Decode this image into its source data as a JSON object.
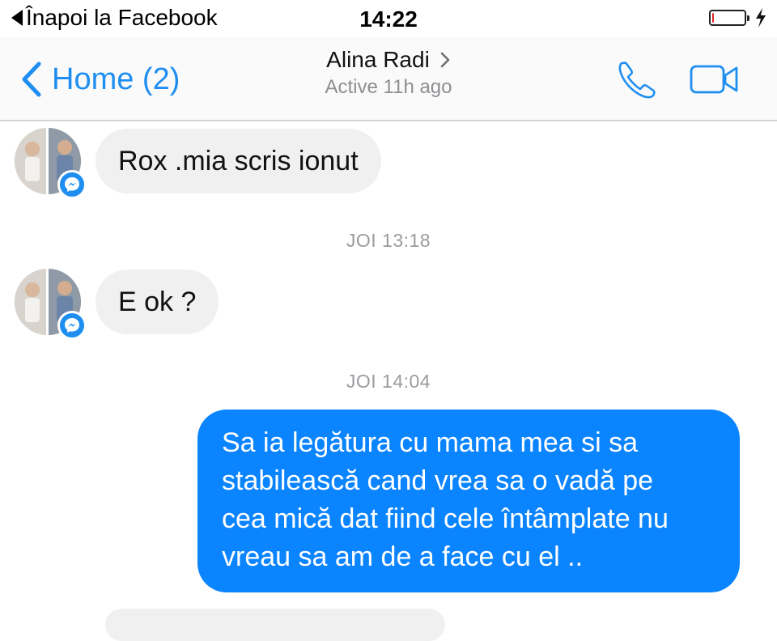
{
  "status_bar": {
    "back_app_label": "Înapoi la Facebook",
    "time": "14:22",
    "battery_percent": 5,
    "battery_color": "#e3262c",
    "charging_icon": "bolt-icon"
  },
  "header": {
    "back_label": "Home (2)",
    "contact_name": "Alina Radi",
    "contact_status": "Active 11h ago",
    "call_icon": "phone-icon",
    "video_icon": "video-camera-icon",
    "accent_color": "#1f8ef1"
  },
  "messages": [
    {
      "direction": "incoming",
      "text": "Rox .mia scris ionut"
    },
    {
      "type": "timestamp",
      "text": "JOI 13:18"
    },
    {
      "direction": "incoming",
      "text": "E ok ?"
    },
    {
      "type": "timestamp",
      "text": "JOI 14:04"
    },
    {
      "direction": "outgoing",
      "lines": [
        "Sa ia legătura cu mama mea si sa",
        "stabilească cand vrea sa o vadă pe",
        "cea mică dat fiind cele întâmplate nu",
        "vreau sa am de a face cu el .."
      ]
    }
  ],
  "colors": {
    "outgoing_bubble": "#0a84ff",
    "incoming_bubble": "#f1f0f0",
    "timestamp_text": "#9b9b9f"
  }
}
